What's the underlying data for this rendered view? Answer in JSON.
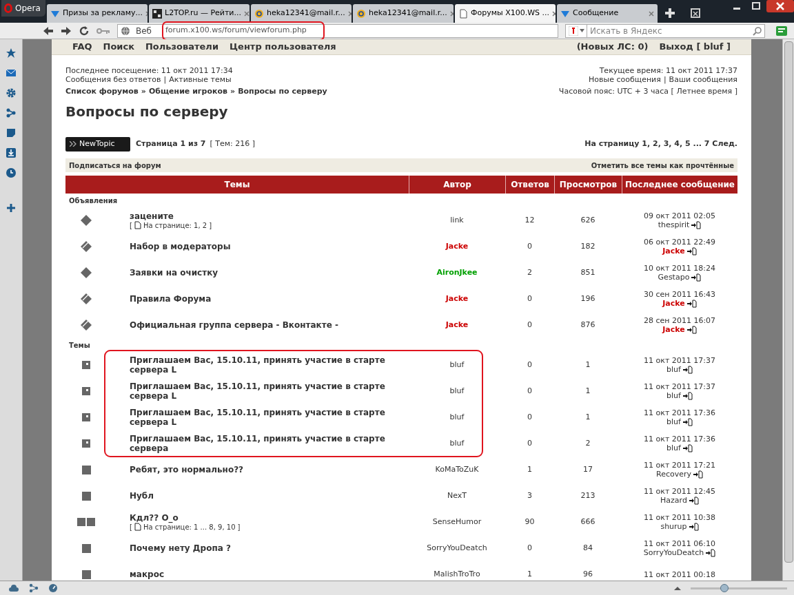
{
  "browser": {
    "menu_button": "Opera",
    "tabs": [
      {
        "title": "Призы за рекламу...",
        "selected": false,
        "kind": "vtab"
      },
      {
        "title": "L2TOP.ru — Рейти...",
        "selected": false,
        "kind": "site"
      },
      {
        "title": "heka12341@mail.r...",
        "selected": false,
        "kind": "mail"
      },
      {
        "title": "heka12341@mail.r...",
        "selected": false,
        "kind": "mail"
      },
      {
        "title": "Форумы X100.WS ...",
        "selected": true,
        "kind": "page"
      },
      {
        "title": "Сообщение",
        "selected": false,
        "kind": "vtab"
      }
    ],
    "address_label": "Веб",
    "url": "forum.x100.ws/forum/viewforum.php",
    "search_placeholder": "Искать в Яндекс",
    "zoom_slider": {
      "level": 0.35
    }
  },
  "navbar": {
    "links": [
      "FAQ",
      "Поиск",
      "Пользователи",
      "Центр пользователя"
    ],
    "right_links": [
      "(Новых ЛС: 0)",
      "Выход [ bluf ]"
    ]
  },
  "info": {
    "last_visit": "Последнее посещение: 11 окт 2011 17:34",
    "left_links": [
      "Сообщения без ответов",
      "Активные темы"
    ],
    "current_time": "Текущее время: 11 окт 2011 17:37",
    "right_links": [
      "Новые сообщения",
      "Ваши сообщения"
    ],
    "separator": "|",
    "timezone": "Часовой пояс: UTC + 3 часа [ Летнее время ]"
  },
  "breadcrumb": {
    "items": [
      "Список форумов",
      "Общение игроков",
      "Вопросы по серверу"
    ],
    "separator": "»"
  },
  "title": "Вопросы по серверу",
  "actions": {
    "new_topic": "NewTopic",
    "page": "Страница 1 из 7",
    "count": "[ Тем: 216 ]",
    "pagination": "На страницу 1, 2, 3, 4, 5 ... 7 След.",
    "subscribe": "Подписаться на форум",
    "mark_read": "Отметить все темы как прочтённые"
  },
  "table": {
    "columns": [
      "Темы",
      "Автор",
      "Ответов",
      "Просмотров",
      "Последнее сообщение"
    ],
    "sections": [
      {
        "label": "Объявления",
        "rows": [
          {
            "kind": "diamond",
            "title": "зацените",
            "pages": {
              "open": "[",
              "label": "На странице: 1, 2",
              "close": "]"
            },
            "author": {
              "name": "link"
            },
            "replies": "12",
            "views": "626",
            "last_time": "09 окт 2011 02:05",
            "last_author": {
              "name": "thespirit"
            }
          },
          {
            "kind": "split",
            "title": "Набор в модераторы",
            "author": {
              "name": "Jacke",
              "color": "#cc0000"
            },
            "replies": "0",
            "views": "182",
            "last_time": "06 окт 2011 22:49",
            "last_author": {
              "name": "Jacke",
              "color": "#cc0000"
            }
          },
          {
            "kind": "diamond",
            "title": "Заявки на очистку",
            "author": {
              "name": "AironJkee",
              "color": "#00a000"
            },
            "replies": "2",
            "views": "851",
            "last_time": "10 окт 2011 18:24",
            "last_author": {
              "name": "Gestapo"
            }
          },
          {
            "kind": "split",
            "title": "Правила Форума",
            "author": {
              "name": "Jacke",
              "color": "#cc0000"
            },
            "replies": "0",
            "views": "196",
            "last_time": "30 сен 2011 16:43",
            "last_author": {
              "name": "Jacke",
              "color": "#cc0000"
            }
          },
          {
            "kind": "split",
            "title": "Официальная группа сервера - Вконтакте -",
            "author": {
              "name": "Jacke",
              "color": "#cc0000"
            },
            "replies": "0",
            "views": "876",
            "last_time": "28 сен 2011 16:07",
            "last_author": {
              "name": "Jacke",
              "color": "#cc0000"
            }
          }
        ]
      },
      {
        "label": "Темы",
        "rows": [
          {
            "kind": "new",
            "title": "Приглашаем Вас, 15.10.11, принять участие в старте сервера L",
            "author": {
              "name": "bluf"
            },
            "replies": "0",
            "views": "1",
            "last_time": "11 окт 2011 17:37",
            "last_author": {
              "name": "bluf"
            },
            "circled": true
          },
          {
            "kind": "new",
            "title": "Приглашаем Вас, 15.10.11, принять участие в старте сервера L",
            "author": {
              "name": "bluf"
            },
            "replies": "0",
            "views": "1",
            "last_time": "11 окт 2011 17:37",
            "last_author": {
              "name": "bluf"
            },
            "circled": true
          },
          {
            "kind": "new",
            "title": "Приглашаем Вас, 15.10.11, принять участие в старте сервера L",
            "author": {
              "name": "bluf"
            },
            "replies": "0",
            "views": "1",
            "last_time": "11 окт 2011 17:36",
            "last_author": {
              "name": "bluf"
            },
            "circled": true
          },
          {
            "kind": "new",
            "title": "Приглашаем Вас, 15.10.11, принять участие в старте сервера",
            "author": {
              "name": "bluf"
            },
            "replies": "0",
            "views": "2",
            "last_time": "11 окт 2011 17:36",
            "last_author": {
              "name": "bluf"
            },
            "circled": true
          },
          {
            "kind": "topic",
            "title": "Ребят, это нормально??",
            "author": {
              "name": "KoMaToZuK"
            },
            "replies": "1",
            "views": "17",
            "last_time": "11 окт 2011 17:21",
            "last_author": {
              "name": "Recovery"
            },
            "circled": false
          },
          {
            "kind": "topic",
            "title": "Нубл",
            "author": {
              "name": "NexT"
            },
            "replies": "3",
            "views": "213",
            "last_time": "11 окт 2011 12:45",
            "last_author": {
              "name": "Hazard"
            },
            "circled": false
          },
          {
            "kind": "hot",
            "title": "Кдл?? О_о",
            "pages": {
              "open": "[",
              "label": "На странице: 1 ... 8, 9, 10",
              "close": "]"
            },
            "author": {
              "name": "SenseHumor"
            },
            "replies": "90",
            "views": "666",
            "last_time": "11 окт 2011 10:38",
            "last_author": {
              "name": "shurup"
            },
            "circled": false
          },
          {
            "kind": "topic",
            "title": "Почему нету Дропа ?",
            "author": {
              "name": "SorryYouDeatch"
            },
            "replies": "0",
            "views": "84",
            "last_time": "11 окт 2011 06:10",
            "last_author": {
              "name": "SorryYouDeatch"
            },
            "circled": false
          },
          {
            "kind": "topic",
            "title": "макрос",
            "author": {
              "name": "MalishTroTro"
            },
            "replies": "1",
            "views": "96",
            "last_time": "11 окт 2011 00:18",
            "circled": false
          }
        ]
      }
    ]
  }
}
